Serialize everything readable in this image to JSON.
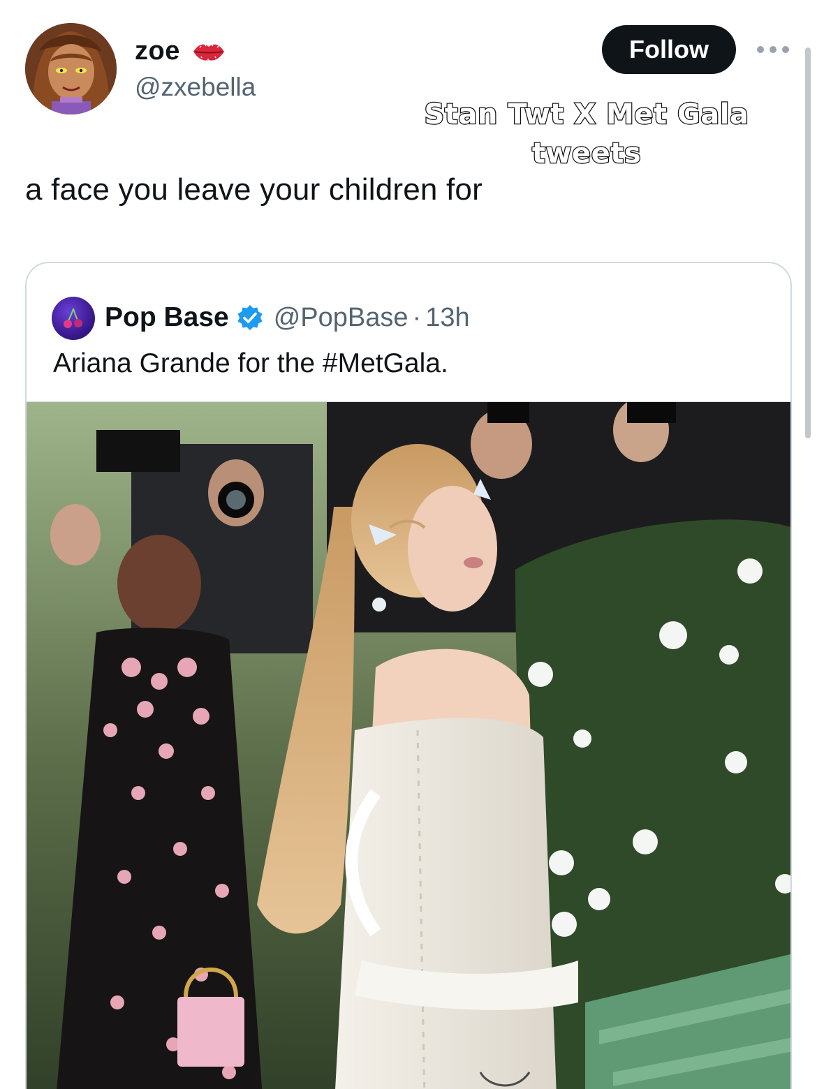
{
  "author": {
    "display_name": "zoe",
    "name_emoji_icon": "kiss-lips-icon",
    "handle": "@zxebella"
  },
  "follow_label": "Follow",
  "overlay_caption": {
    "line1": "Stan Twt X Met Gala",
    "line2": "tweets"
  },
  "tweet_text": "a face you leave your children for",
  "quoted_tweet": {
    "display_name": "Pop Base",
    "verified_icon": "verified-badge-icon",
    "handle": "@PopBase",
    "separator": "·",
    "time": "13h",
    "text": "Ariana Grande for the #MetGala.",
    "media_icon": "photo"
  },
  "colors": {
    "text_primary": "#0f1419",
    "text_secondary": "#536471",
    "follow_bg": "#0f1419",
    "verified_blue": "#1d9bf0",
    "card_border": "#cfd9de"
  }
}
